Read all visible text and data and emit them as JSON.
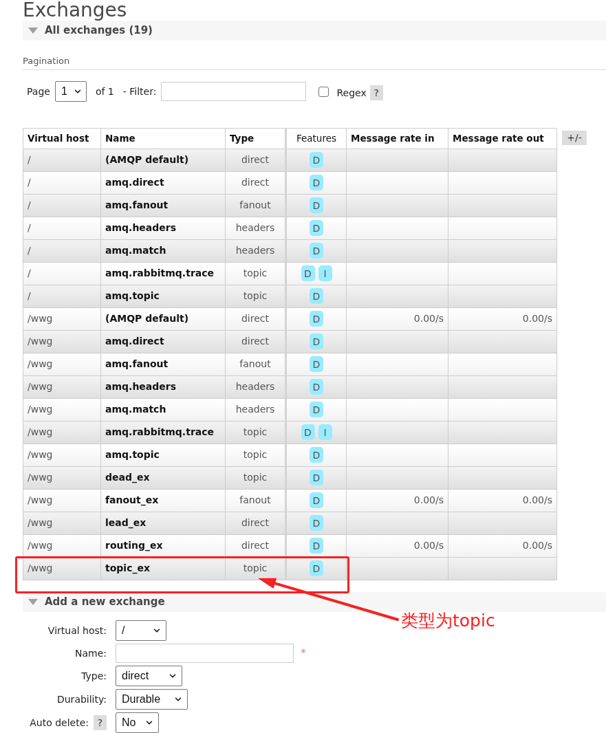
{
  "page_title": "Exchanges",
  "section": {
    "title": "All exchanges (19)",
    "expanded": true
  },
  "pagination": {
    "heading": "Pagination",
    "page_label": "Page",
    "page_value": "1",
    "of_label": "of 1",
    "filter_label": "- Filter:",
    "regex": {
      "label": "Regex",
      "checked": false
    },
    "help": "?"
  },
  "table": {
    "columns": [
      {
        "label": "Virtual host",
        "kind": "sortable"
      },
      {
        "label": "Name",
        "kind": "sortable"
      },
      {
        "label": "Type",
        "kind": "sortable"
      },
      {
        "label": "Features",
        "kind": "plain"
      },
      {
        "label": "Message rate in",
        "kind": "sortable"
      },
      {
        "label": "Message rate out",
        "kind": "sortable"
      }
    ],
    "toggle_button": "+/-",
    "rows": [
      {
        "virtual_host": "/",
        "name": "(AMQP default)",
        "type": "direct",
        "features": [
          "D"
        ]
      },
      {
        "virtual_host": "/",
        "name": "amq.direct",
        "type": "direct",
        "features": [
          "D"
        ]
      },
      {
        "virtual_host": "/",
        "name": "amq.fanout",
        "type": "fanout",
        "features": [
          "D"
        ]
      },
      {
        "virtual_host": "/",
        "name": "amq.headers",
        "type": "headers",
        "features": [
          "D"
        ]
      },
      {
        "virtual_host": "/",
        "name": "amq.match",
        "type": "headers",
        "features": [
          "D"
        ]
      },
      {
        "virtual_host": "/",
        "name": "amq.rabbitmq.trace",
        "type": "topic",
        "features": [
          "D",
          "I"
        ]
      },
      {
        "virtual_host": "/",
        "name": "amq.topic",
        "type": "topic",
        "features": [
          "D"
        ]
      },
      {
        "virtual_host": "/wwg",
        "name": "(AMQP default)",
        "type": "direct",
        "features": [
          "D"
        ],
        "rate_in": "0.00/s",
        "rate_out": "0.00/s"
      },
      {
        "virtual_host": "/wwg",
        "name": "amq.direct",
        "type": "direct",
        "features": [
          "D"
        ]
      },
      {
        "virtual_host": "/wwg",
        "name": "amq.fanout",
        "type": "fanout",
        "features": [
          "D"
        ]
      },
      {
        "virtual_host": "/wwg",
        "name": "amq.headers",
        "type": "headers",
        "features": [
          "D"
        ]
      },
      {
        "virtual_host": "/wwg",
        "name": "amq.match",
        "type": "headers",
        "features": [
          "D"
        ]
      },
      {
        "virtual_host": "/wwg",
        "name": "amq.rabbitmq.trace",
        "type": "topic",
        "features": [
          "D",
          "I"
        ]
      },
      {
        "virtual_host": "/wwg",
        "name": "amq.topic",
        "type": "topic",
        "features": [
          "D"
        ]
      },
      {
        "virtual_host": "/wwg",
        "name": "dead_ex",
        "type": "topic",
        "features": [
          "D"
        ]
      },
      {
        "virtual_host": "/wwg",
        "name": "fanout_ex",
        "type": "fanout",
        "features": [
          "D"
        ],
        "rate_in": "0.00/s",
        "rate_out": "0.00/s"
      },
      {
        "virtual_host": "/wwg",
        "name": "lead_ex",
        "type": "direct",
        "features": [
          "D"
        ]
      },
      {
        "virtual_host": "/wwg",
        "name": "routing_ex",
        "type": "direct",
        "features": [
          "D"
        ],
        "rate_in": "0.00/s",
        "rate_out": "0.00/s"
      },
      {
        "virtual_host": "/wwg",
        "name": "topic_ex",
        "type": "topic",
        "features": [
          "D"
        ]
      }
    ]
  },
  "annotation": {
    "text": "类型为topic"
  },
  "add_section": {
    "title": "Add a new exchange",
    "expanded": true,
    "fields": [
      {
        "kind": "select",
        "label": "Virtual host:",
        "value": "/"
      },
      {
        "kind": "text",
        "label": "Name:",
        "required_mark": "*"
      },
      {
        "kind": "select",
        "label": "Type:",
        "value": "direct"
      },
      {
        "kind": "select",
        "label": "Durability:",
        "value": "Durable"
      },
      {
        "kind": "select",
        "label": "Auto delete:",
        "value": "No",
        "help": "?"
      }
    ]
  }
}
